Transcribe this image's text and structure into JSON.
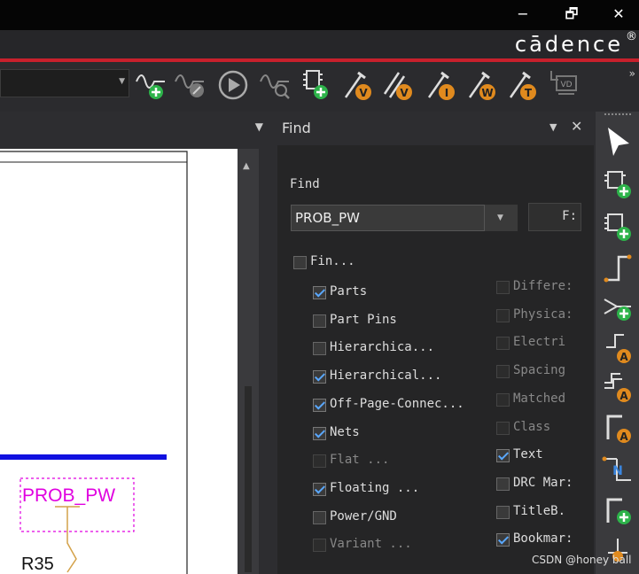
{
  "titlebar": {
    "minimize": "−",
    "maximize": "🗗",
    "close": "✕"
  },
  "brand": {
    "name": "cādence",
    "reg": "®"
  },
  "toolbar": {
    "more": "»",
    "probe_labels": [
      "V",
      "V",
      "I",
      "W",
      "T"
    ],
    "vd_label": "VD"
  },
  "find_panel": {
    "title": "Find",
    "find_label": "Find",
    "query": "PROB_PW",
    "find_button": "F:",
    "find_in_label": "Fin...",
    "left_options": [
      {
        "label": "Parts",
        "checked": true,
        "enabled": true
      },
      {
        "label": "Part Pins",
        "checked": false,
        "enabled": true
      },
      {
        "label": "Hierarchica...",
        "checked": false,
        "enabled": true
      },
      {
        "label": "Hierarchical...",
        "checked": true,
        "enabled": true
      },
      {
        "label": "Off-Page-Connec...",
        "checked": true,
        "enabled": true
      },
      {
        "label": "Nets",
        "checked": true,
        "enabled": true
      },
      {
        "label": "Flat ...",
        "checked": false,
        "enabled": false
      },
      {
        "label": "Floating ...",
        "checked": true,
        "enabled": true
      },
      {
        "label": "Power/GND",
        "checked": false,
        "enabled": true
      },
      {
        "label": "Variant ...",
        "checked": false,
        "enabled": false
      }
    ],
    "right_options": [
      {
        "label": "Differe:",
        "checked": false,
        "enabled": false
      },
      {
        "label": "Physica:",
        "checked": false,
        "enabled": false
      },
      {
        "label": "Electri",
        "checked": false,
        "enabled": false
      },
      {
        "label": "Spacing",
        "checked": false,
        "enabled": false
      },
      {
        "label": "Matched",
        "checked": false,
        "enabled": false
      },
      {
        "label": "Class",
        "checked": false,
        "enabled": false
      },
      {
        "label": "Text",
        "checked": true,
        "enabled": true
      },
      {
        "label": "DRC Mar:",
        "checked": false,
        "enabled": true
      },
      {
        "label": "TitleB.",
        "checked": false,
        "enabled": true
      },
      {
        "label": "Bookmar:",
        "checked": true,
        "enabled": true
      }
    ]
  },
  "schematic": {
    "net_label": "PROB_PW",
    "ref_label": "R35"
  },
  "colors": {
    "accent_green": "#2db34a",
    "probe_orange": "#e08a1e",
    "net_blue": "#1010e0",
    "label_magenta": "#e000e0",
    "brand_red": "#c8202c"
  },
  "watermark": "CSDN @honey ball"
}
